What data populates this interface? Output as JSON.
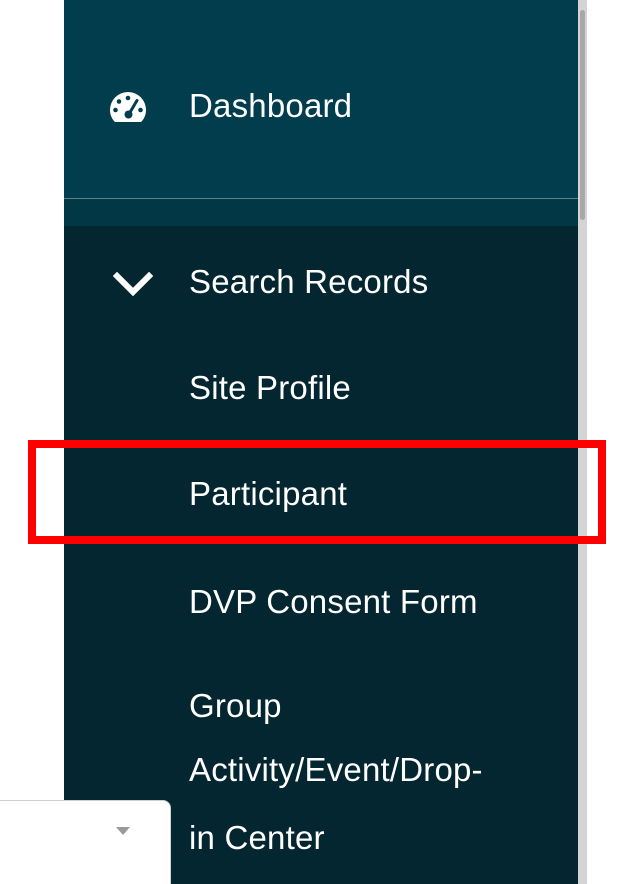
{
  "sidebar": {
    "dashboard": {
      "label": "Dashboard",
      "icon": "tachometer-icon"
    },
    "search_records": {
      "label": "Search Records",
      "icon": "chevron-down-icon",
      "expanded": true
    },
    "items": [
      {
        "label": "Site Profile"
      },
      {
        "label": "Participant",
        "highlighted": true
      },
      {
        "label": "DVP Consent Form"
      },
      {
        "label": "Group"
      },
      {
        "label": "Activity/Event/Drop-"
      },
      {
        "label": "in Center"
      }
    ]
  },
  "dropdown": {
    "icon": "caret-down-icon"
  },
  "colors": {
    "sidebar_bg": "#032630",
    "dashboard_bg": "#023d4e",
    "text": "#ffffff",
    "highlight": "#ff0000"
  }
}
